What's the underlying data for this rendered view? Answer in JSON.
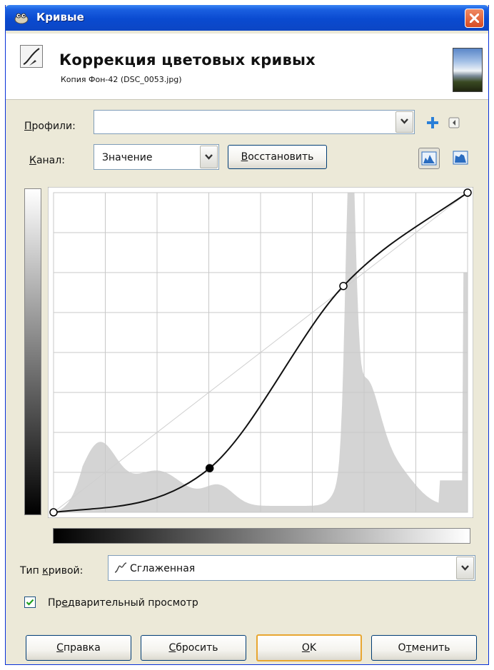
{
  "window": {
    "title": "Кривые"
  },
  "header": {
    "title": "Коррекция цветовых кривых",
    "subtitle": "Копия Фон-42 (DSC_0053.jpg)"
  },
  "presets": {
    "label_prefix": "П",
    "label_rest": "рофили:",
    "value": ""
  },
  "channel": {
    "label_prefix": "К",
    "label_rest": "анал:",
    "value": "Значение",
    "reset_prefix": "В",
    "reset_rest": "осстановить"
  },
  "curve": {
    "points": [
      [
        0,
        0
      ],
      [
        0.377,
        0.138
      ],
      [
        0.7,
        0.708
      ],
      [
        1,
        1
      ]
    ],
    "selected_point": 1,
    "grid_divisions": 8
  },
  "curve_type": {
    "label_before": "Тип ",
    "label_key": "к",
    "label_after": "ривой:",
    "value": "Сглаженная"
  },
  "preview": {
    "label_before": "Пр",
    "label_key": "е",
    "label_after": "дварительный просмотр",
    "checked": true
  },
  "buttons": {
    "help_key": "С",
    "help_rest": "правка",
    "reset_key": "С",
    "reset_rest": "бросить",
    "ok_key": "О",
    "ok_rest": "K",
    "cancel_before": "О",
    "cancel_key": "т",
    "cancel_after": "менить"
  },
  "colors": {
    "histogram": "#d4d4d4",
    "grid": "#c8c8c8",
    "curve": "#111111",
    "diagonal": "#cfcfcf"
  }
}
